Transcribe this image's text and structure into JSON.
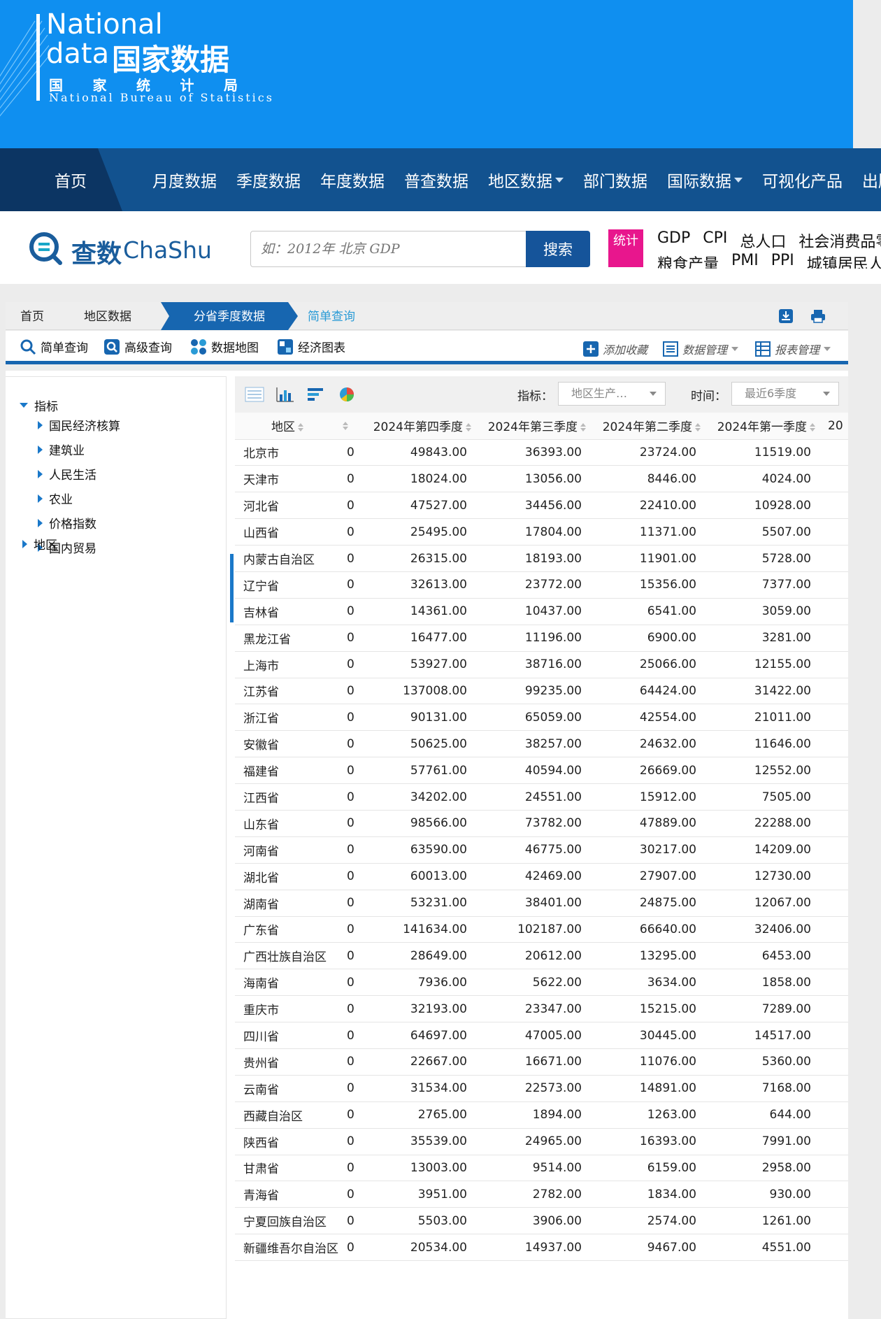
{
  "banner": {
    "logo_en_line1": "National",
    "logo_en_line2": "data",
    "logo_cn_line1": "国家数据",
    "logo_cn_line2": [
      "国",
      "家",
      "统",
      "计",
      "局"
    ],
    "logo_en_line3": "National Bureau of Statistics",
    "background_color": "#0f8ff0"
  },
  "nav": {
    "items": [
      {
        "label": "首页",
        "has_dropdown": false
      },
      {
        "label": "月度数据",
        "has_dropdown": false
      },
      {
        "label": "季度数据",
        "has_dropdown": false
      },
      {
        "label": "年度数据",
        "has_dropdown": false
      },
      {
        "label": "普查数据",
        "has_dropdown": false
      },
      {
        "label": "地区数据",
        "has_dropdown": true
      },
      {
        "label": "部门数据",
        "has_dropdown": false
      },
      {
        "label": "国际数据",
        "has_dropdown": true
      },
      {
        "label": "可视化产品",
        "has_dropdown": false
      },
      {
        "label": "出版",
        "has_dropdown": false
      }
    ],
    "background_color": "#12528f"
  },
  "search": {
    "brand_cn": "查数",
    "brand_en": "ChaShu",
    "placeholder": "如：2012年 北京 GDP",
    "button_label": "搜索",
    "stat_badge": "统计",
    "hot_row1": [
      "GDP",
      "CPI",
      "总人口",
      "社会消费品零"
    ],
    "hot_row2": [
      "粮食产量",
      "PMI",
      "PPI",
      "城镇居民人"
    ]
  },
  "breadcrumb": {
    "items": [
      "首页",
      "地区数据"
    ],
    "active": "分省季度数据",
    "link": "简单查询"
  },
  "toolbar": {
    "tools": [
      "简单查询",
      "高级查询",
      "数据地图",
      "经济图表"
    ],
    "right_tools": [
      "添加收藏",
      "数据管理",
      "报表管理"
    ]
  },
  "sidebar": {
    "root_indicator": "指标",
    "indicator_children": [
      "国民经济核算",
      "建筑业",
      "人民生活",
      "农业",
      "价格指数",
      "国内贸易"
    ],
    "root_region": "地区"
  },
  "controls": {
    "indicator_label": "指标：",
    "indicator_value": "地区生产…",
    "time_label": "时间：",
    "time_value": "最近6季度"
  },
  "table": {
    "columns": [
      "地区",
      "",
      "2024年第四季度",
      "2024年第三季度",
      "2024年第二季度",
      "2024年第一季度",
      "20"
    ],
    "rows": [
      [
        "北京市",
        "0",
        "49843.00",
        "36393.00",
        "23724.00",
        "11519.00"
      ],
      [
        "天津市",
        "0",
        "18024.00",
        "13056.00",
        "8446.00",
        "4024.00"
      ],
      [
        "河北省",
        "0",
        "47527.00",
        "34456.00",
        "22410.00",
        "10928.00"
      ],
      [
        "山西省",
        "0",
        "25495.00",
        "17804.00",
        "11371.00",
        "5507.00"
      ],
      [
        "内蒙古自治区",
        "0",
        "26315.00",
        "18193.00",
        "11901.00",
        "5728.00"
      ],
      [
        "辽宁省",
        "0",
        "32613.00",
        "23772.00",
        "15356.00",
        "7377.00"
      ],
      [
        "吉林省",
        "0",
        "14361.00",
        "10437.00",
        "6541.00",
        "3059.00"
      ],
      [
        "黑龙江省",
        "0",
        "16477.00",
        "11196.00",
        "6900.00",
        "3281.00"
      ],
      [
        "上海市",
        "0",
        "53927.00",
        "38716.00",
        "25066.00",
        "12155.00"
      ],
      [
        "江苏省",
        "0",
        "137008.00",
        "99235.00",
        "64424.00",
        "31422.00"
      ],
      [
        "浙江省",
        "0",
        "90131.00",
        "65059.00",
        "42554.00",
        "21011.00"
      ],
      [
        "安徽省",
        "0",
        "50625.00",
        "38257.00",
        "24632.00",
        "11646.00"
      ],
      [
        "福建省",
        "0",
        "57761.00",
        "40594.00",
        "26669.00",
        "12552.00"
      ],
      [
        "江西省",
        "0",
        "34202.00",
        "24551.00",
        "15912.00",
        "7505.00"
      ],
      [
        "山东省",
        "0",
        "98566.00",
        "73782.00",
        "47889.00",
        "22288.00"
      ],
      [
        "河南省",
        "0",
        "63590.00",
        "46775.00",
        "30217.00",
        "14209.00"
      ],
      [
        "湖北省",
        "0",
        "60013.00",
        "42469.00",
        "27907.00",
        "12730.00"
      ],
      [
        "湖南省",
        "0",
        "53231.00",
        "38401.00",
        "24875.00",
        "12067.00"
      ],
      [
        "广东省",
        "0",
        "141634.00",
        "102187.00",
        "66640.00",
        "32406.00"
      ],
      [
        "广西壮族自治区",
        "0",
        "28649.00",
        "20612.00",
        "13295.00",
        "6453.00"
      ],
      [
        "海南省",
        "0",
        "7936.00",
        "5622.00",
        "3634.00",
        "1858.00"
      ],
      [
        "重庆市",
        "0",
        "32193.00",
        "23347.00",
        "15215.00",
        "7289.00"
      ],
      [
        "四川省",
        "0",
        "64697.00",
        "47005.00",
        "30445.00",
        "14517.00"
      ],
      [
        "贵州省",
        "0",
        "22667.00",
        "16671.00",
        "11076.00",
        "5360.00"
      ],
      [
        "云南省",
        "0",
        "31534.00",
        "22573.00",
        "14891.00",
        "7168.00"
      ],
      [
        "西藏自治区",
        "0",
        "2765.00",
        "1894.00",
        "1263.00",
        "644.00"
      ],
      [
        "陕西省",
        "0",
        "35539.00",
        "24965.00",
        "16393.00",
        "7991.00"
      ],
      [
        "甘肃省",
        "0",
        "13003.00",
        "9514.00",
        "6159.00",
        "2958.00"
      ],
      [
        "青海省",
        "0",
        "3951.00",
        "2782.00",
        "1834.00",
        "930.00"
      ],
      [
        "宁夏回族自治区",
        "0",
        "5503.00",
        "3906.00",
        "2574.00",
        "1261.00"
      ],
      [
        "新疆维吾尔自治区",
        "0",
        "20534.00",
        "14937.00",
        "9467.00",
        "4551.00"
      ]
    ]
  },
  "colors": {
    "accent_blue": "#1766b0",
    "stat_magenta": "#e8168d",
    "link_cyan": "#2a9bd6"
  }
}
